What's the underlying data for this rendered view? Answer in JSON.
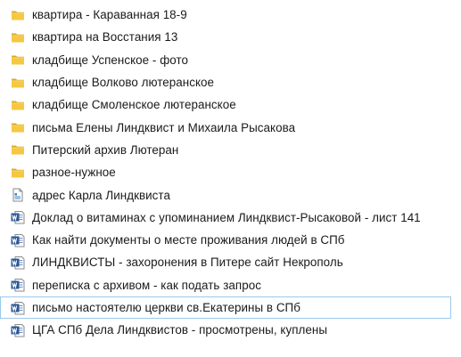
{
  "files": [
    {
      "name": "квартира - Караванная 18-9",
      "icon": "folder-icon"
    },
    {
      "name": "квартира на Восстания 13",
      "icon": "folder-icon"
    },
    {
      "name": "кладбище  Успенское - фото",
      "icon": "folder-icon"
    },
    {
      "name": "кладбище Волково лютеранское",
      "icon": "folder-icon"
    },
    {
      "name": "кладбище Смоленское лютеранское",
      "icon": "folder-icon"
    },
    {
      "name": "письма Елены Линдквист и Михаила Рысакова",
      "icon": "folder-icon"
    },
    {
      "name": "Питерский архив Лютеран",
      "icon": "folder-icon"
    },
    {
      "name": "разное-нужное",
      "icon": "folder-icon"
    },
    {
      "name": "адрес Карла Линдквиста",
      "icon": "document-icon"
    },
    {
      "name": "Доклад о витаминах с упоминанием Линдквист-Рысаковой - лист 141",
      "icon": "word-document-icon"
    },
    {
      "name": "Как найти документы о месте проживания людей в СПб",
      "icon": "word-document-icon"
    },
    {
      "name": "ЛИНДКВИСТЫ - захоронения в Питере сайт Некрополь",
      "icon": "word-document-icon"
    },
    {
      "name": "переписка с архивом - как подать запрос",
      "icon": "word-document-icon"
    },
    {
      "name": "письмо настоятелю церкви св.Екатерины в СПб",
      "icon": "word-document-icon"
    },
    {
      "name": "ЦГА СПб Дела Линдквистов - просмотрены, куплены",
      "icon": "word-document-icon"
    }
  ],
  "colors": {
    "folder": "#f5c842",
    "folder_dark": "#e0a820",
    "word_blue": "#2b5797",
    "selection_border": "#99c9ef"
  }
}
